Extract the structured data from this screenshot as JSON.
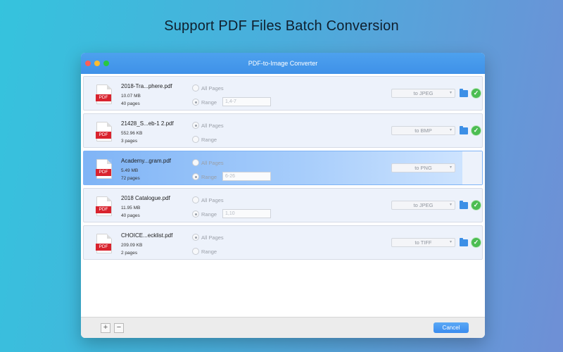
{
  "headline": "Support PDF Files Batch Conversion",
  "window": {
    "title": "PDF-to-Image Converter"
  },
  "options": {
    "all_pages": "All Pages",
    "range": "Range"
  },
  "pdf_icon_label": "PDF",
  "files": [
    {
      "name": "2018-Tra...phere.pdf",
      "size": "10.07 MB",
      "pages": "40 pages",
      "mode": "range",
      "range": "1,4-7",
      "format": "to JPEG",
      "done": true,
      "selected": false
    },
    {
      "name": "21428_S...eb-1 2.pdf",
      "size": "552.96 KB",
      "pages": "3 pages",
      "mode": "all",
      "range": "",
      "format": "to BMP",
      "done": true,
      "selected": false
    },
    {
      "name": "Academy...gram.pdf",
      "size": "5.49 MB",
      "pages": "72 pages",
      "mode": "range",
      "range": "6-26",
      "format": "to PNG",
      "done": false,
      "selected": true
    },
    {
      "name": "2018 Catalogue.pdf",
      "size": "11.95 MB",
      "pages": "40 pages",
      "mode": "range",
      "range": "1,10",
      "format": "to JPEG",
      "done": true,
      "selected": false
    },
    {
      "name": "CHOICE...ecklist.pdf",
      "size": "209.09 KB",
      "pages": "2 pages",
      "mode": "all",
      "range": "",
      "format": "to TIFF",
      "done": true,
      "selected": false
    }
  ],
  "footer": {
    "add_label": "+",
    "remove_label": "−",
    "cancel_label": "Cancel"
  },
  "colors": {
    "accent": "#3f91e8",
    "pdf_red": "#d9232e",
    "success": "#4cbd52",
    "selection": "#7fb4f6"
  }
}
